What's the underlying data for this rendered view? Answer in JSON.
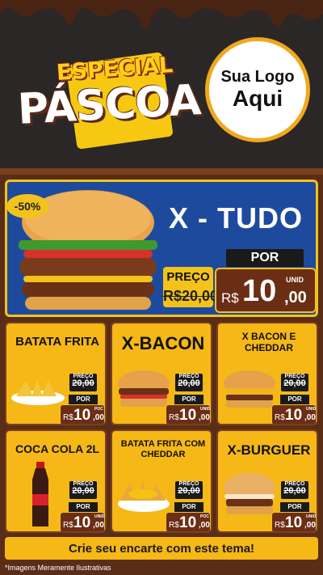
{
  "header": {
    "tag_top": "ESPECIAL",
    "tag_main": "PÁSCOA",
    "logo_line1": "Sua Logo",
    "logo_line2": "Aqui"
  },
  "hero": {
    "discount": "-50%",
    "title": "X - TUDO",
    "preco_label": "PREÇO",
    "old_price": "R$20,00",
    "por_label": "POR",
    "currency": "R$",
    "price_int": "10",
    "price_cents": ",00",
    "unit": "UNID"
  },
  "products": [
    {
      "title": "BATATA FRITA",
      "preco_label": "PREÇO",
      "old_price": "20,00",
      "por": "POR",
      "currency": "R$",
      "int": "10",
      "cents": ",00",
      "unit": "POC"
    },
    {
      "title": "X-BACON",
      "preco_label": "PREÇO",
      "old_price": "20,00",
      "por": "POR",
      "currency": "R$",
      "int": "10",
      "cents": ",00",
      "unit": "UNID"
    },
    {
      "title": "X BACON E CHEDDAR",
      "preco_label": "PREÇO",
      "old_price": "20,00",
      "por": "POR",
      "currency": "R$",
      "int": "10",
      "cents": ",00",
      "unit": "UNID"
    },
    {
      "title": "COCA COLA 2L",
      "preco_label": "PREÇO",
      "old_price": "20,00",
      "por": "POR",
      "currency": "R$",
      "int": "10",
      "cents": ",00",
      "unit": "UNID"
    },
    {
      "title": "BATATA FRITA COM CHEDDAR",
      "preco_label": "PREÇO",
      "old_price": "20,00",
      "por": "POR",
      "currency": "R$",
      "int": "10",
      "cents": ",00",
      "unit": "POC"
    },
    {
      "title": "X-BURGUER",
      "preco_label": "PREÇO",
      "old_price": "20,00",
      "por": "POR",
      "currency": "R$",
      "int": "10",
      "cents": ",00",
      "unit": "UNID"
    }
  ],
  "cta": "Crie seu encarte com este tema!",
  "footnote": "*Imagens Meramente Ilustrativas",
  "colors": {
    "chocolate": "#5a2d16",
    "gold": "#f6b817",
    "hero_blue": "#1e4a9e",
    "dark": "#2a2625"
  }
}
